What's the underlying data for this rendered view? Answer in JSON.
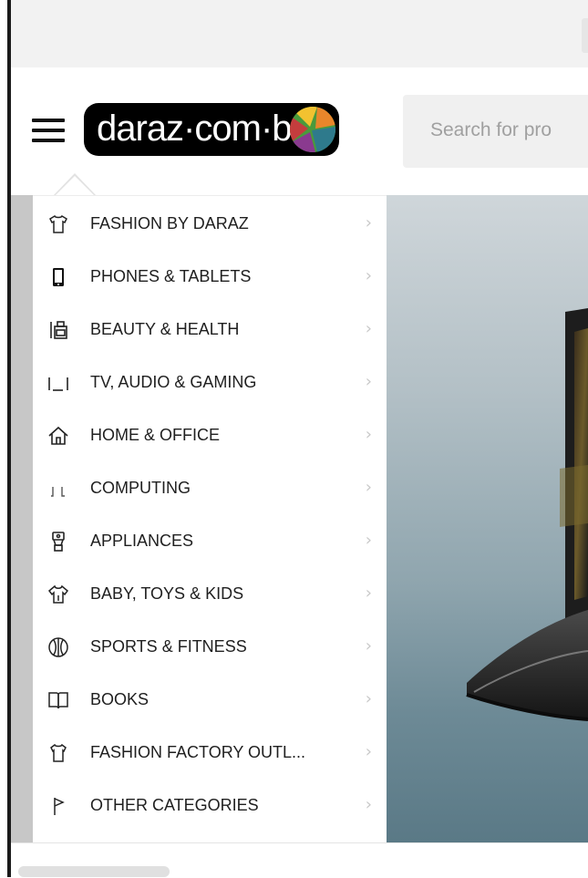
{
  "header": {
    "logo_text": "daraz·com·bd",
    "search_placeholder": "Search for pro"
  },
  "menu": {
    "items": [
      {
        "label": "FASHION BY DARAZ",
        "icon": "tshirt-icon"
      },
      {
        "label": "PHONES & TABLETS",
        "icon": "phone-icon"
      },
      {
        "label": "BEAUTY & HEALTH",
        "icon": "beauty-icon"
      },
      {
        "label": "TV, AUDIO & GAMING",
        "icon": "tv-icon"
      },
      {
        "label": "HOME & OFFICE",
        "icon": "home-icon"
      },
      {
        "label": "COMPUTING",
        "icon": "computing-icon"
      },
      {
        "label": "APPLIANCES",
        "icon": "appliance-icon"
      },
      {
        "label": "BABY, TOYS & KIDS",
        "icon": "baby-shirt-icon"
      },
      {
        "label": "SPORTS & FITNESS",
        "icon": "ball-icon"
      },
      {
        "label": "BOOKS",
        "icon": "book-icon"
      },
      {
        "label": "FASHION FACTORY OUTL...",
        "icon": "outlet-shirt-icon"
      },
      {
        "label": "OTHER CATEGORIES",
        "icon": "flag-icon"
      }
    ],
    "chevron": "›"
  },
  "colors": {
    "logo_bg": "#000000",
    "menu_text": "#1f1f1f",
    "chevron": "#c8c8c8"
  }
}
